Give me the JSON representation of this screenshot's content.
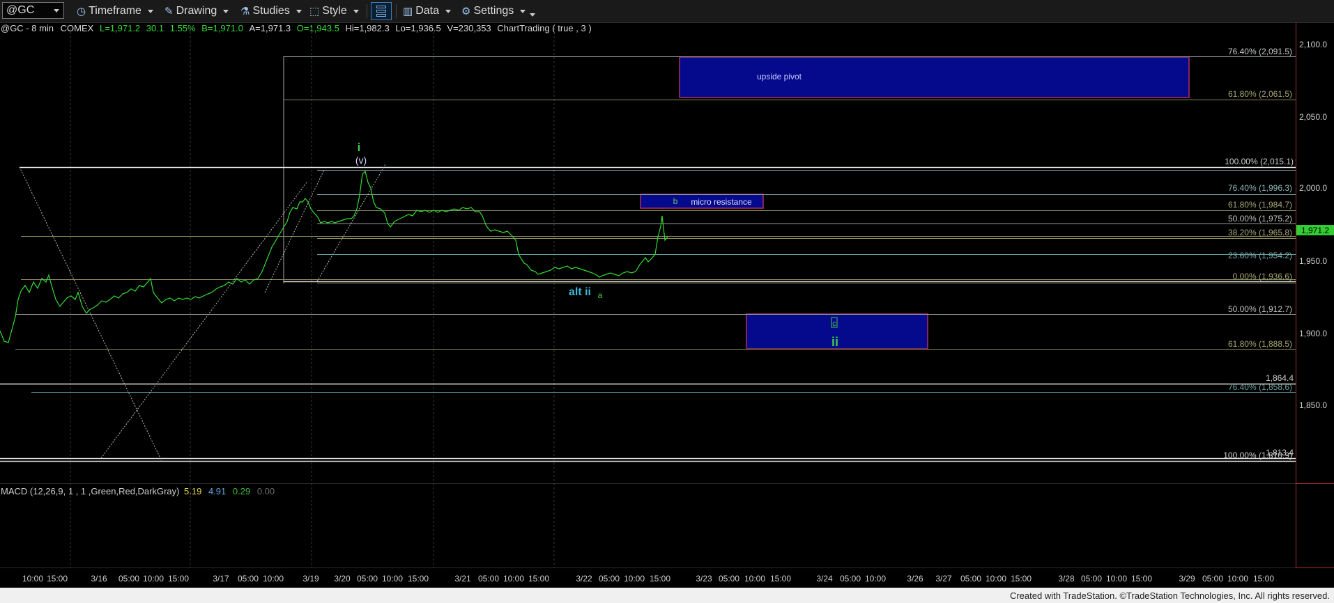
{
  "toolbar": {
    "symbol": "@GC",
    "timeframe": "Timeframe",
    "drawing": "Drawing",
    "studies": "Studies",
    "style": "Style",
    "data": "Data",
    "settings": "Settings"
  },
  "header": {
    "symbol": "@GC - 8 min",
    "exchange": "COMEX",
    "last": "L=1,971.2",
    "change": "30.1",
    "change_pct": "1.55%",
    "bid": "B=1,971.0",
    "ask": "A=1,971.3",
    "open": "O=1,943.5",
    "high": "Hi=1,982.3",
    "low": "Lo=1,936.5",
    "volume": "V=230,353",
    "study": "ChartTrading ( true , 3 )"
  },
  "price_axis": {
    "ticks": [
      "2,100.0",
      "2,050.0",
      "2,000.0",
      "1,950.0",
      "1,900.0",
      "1,850.0"
    ],
    "last_price": "1,971.2"
  },
  "fib_labels": [
    {
      "text": "76.40% (2,091.5)",
      "color": "#c8c8c8"
    },
    {
      "text": "61.80% (2,061.5)",
      "color": "#a8a878"
    },
    {
      "text": "100.00% (2,015.1)",
      "color": "#d0d0d0"
    },
    {
      "text": "76.40% (1,996.3)",
      "color": "#8fb8b8"
    },
    {
      "text": "61.80% (1,984.7)",
      "color": "#a8a878"
    },
    {
      "text": "50.00% (1,975.2)",
      "color": "#c0c0c0"
    },
    {
      "text": "38.20% (1,965.8)",
      "color": "#a8a878"
    },
    {
      "text": "23.60% (1,954.2)",
      "color": "#7fb0b0"
    },
    {
      "text": "0.00% (1,936.6)",
      "color": "#a8a878"
    },
    {
      "text": "50.00% (1,912.7)",
      "color": "#c0c0c0"
    },
    {
      "text": "61.80% (1,888.5)",
      "color": "#a8a878"
    },
    {
      "text": "1,864.4",
      "color": "#d0d0d0"
    },
    {
      "text": "76.40% (1,858.6)",
      "color": "#6f9fa0"
    },
    {
      "text": "1,813.4",
      "color": "#d0d0d0"
    },
    {
      "text": "100.00% (1,810.9)",
      "color": "#d0d0d0"
    }
  ],
  "zones": {
    "upside_pivot": "upside pivot",
    "micro_resistance": "micro resistance",
    "micro_b": "b"
  },
  "wave_labels": {
    "i": "i",
    "v": "(v)",
    "alt_ii": "alt ii",
    "a": "a",
    "c": "c",
    "ii": "ii"
  },
  "macd": {
    "label": "MACD (12,26,9, 1 , 1 ,Green,Red,DarkGray)",
    "values": [
      "5.19",
      "4.91",
      "0.29",
      "0.00"
    ],
    "colors": [
      "#e8d84a",
      "#6aa7e0",
      "#3fbf3f",
      "#6c6c6c"
    ]
  },
  "time_axis": [
    "10:00",
    "15:00",
    "3/16",
    "05:00",
    "10:00",
    "15:00",
    "3/17",
    "05:00",
    "10:00",
    "3/19",
    "3/20",
    "05:00",
    "10:00",
    "15:00",
    "3/21",
    "05:00",
    "10:00",
    "15:00",
    "3/22",
    "05:00",
    "10:00",
    "15:00",
    "3/23",
    "05:00",
    "10:00",
    "15:00",
    "3/24",
    "05:00",
    "10:00",
    "3/26",
    "3/27",
    "05:00",
    "10:00",
    "15:00",
    "3/28",
    "05:00",
    "10:00",
    "15:00",
    "3/29",
    "05:00",
    "10:00",
    "15:00"
  ],
  "footer": "Created with TradeStation. ©TradeStation Technologies, Inc. All rights reserved.",
  "colors": {
    "price": "#33dd33",
    "zone_fill": "#050a8c",
    "zone_border": "#b03060",
    "wave_green": "#44cc44",
    "wave_cyan": "#3fb8d8"
  }
}
